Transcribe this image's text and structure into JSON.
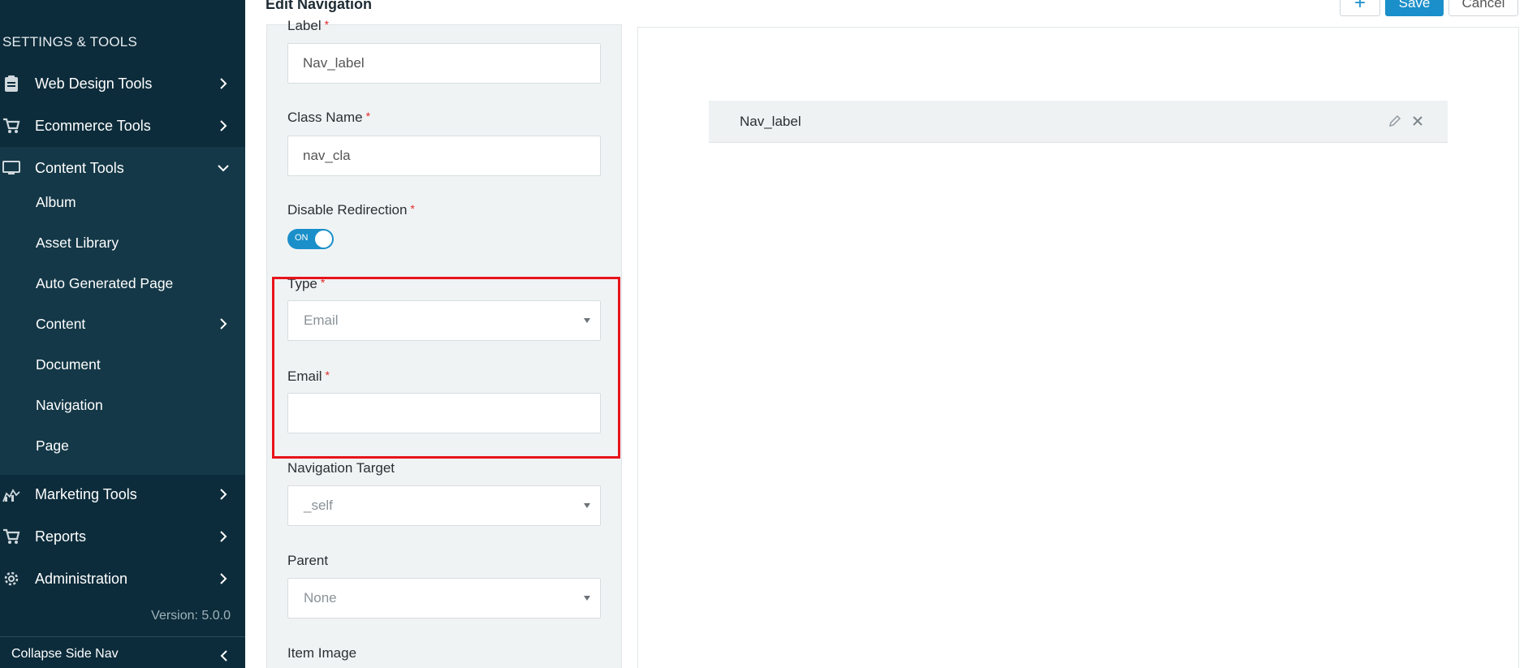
{
  "sidebar": {
    "title": "SETTINGS & TOOLS",
    "items": [
      {
        "label": "Web Design Tools",
        "icon": "clipboard-icon"
      },
      {
        "label": "Ecommerce Tools",
        "icon": "cart-icon"
      },
      {
        "label": "Content Tools",
        "icon": "monitor-icon"
      },
      {
        "label": "Marketing Tools",
        "icon": "chart-icon"
      },
      {
        "label": "Reports",
        "icon": "cart-icon"
      },
      {
        "label": "Administration",
        "icon": "gear-icon"
      }
    ],
    "content_sub_items": [
      {
        "label": "Album"
      },
      {
        "label": "Asset Library"
      },
      {
        "label": "Auto Generated Page"
      },
      {
        "label": "Content"
      },
      {
        "label": "Document"
      },
      {
        "label": "Navigation"
      },
      {
        "label": "Page"
      }
    ],
    "version": "Version: 5.0.0",
    "collapse_label": "Collapse Side Nav"
  },
  "header": {
    "title": "Edit Navigation",
    "add_label": "+",
    "save_label": "Save",
    "cancel_label": "Cancel"
  },
  "form": {
    "label_field": {
      "label": "Label",
      "value": "Nav_label"
    },
    "class_name": {
      "label": "Class Name",
      "value": "nav_cla"
    },
    "disable_redirection": {
      "label": "Disable Redirection",
      "state": "ON"
    },
    "type": {
      "label": "Type",
      "value": "Email"
    },
    "email": {
      "label": "Email",
      "value": ""
    },
    "navigation_target": {
      "label": "Navigation Target",
      "value": "_self"
    },
    "parent": {
      "label": "Parent",
      "value": "None"
    },
    "item_image": {
      "label": "Item Image"
    },
    "required_mark": "*"
  },
  "preview": {
    "nav_item_label": "Nav_label"
  },
  "colors": {
    "sidebar_bg": "#0d2c3b",
    "accent": "#1a8fc9",
    "highlight": "#e8131b"
  }
}
